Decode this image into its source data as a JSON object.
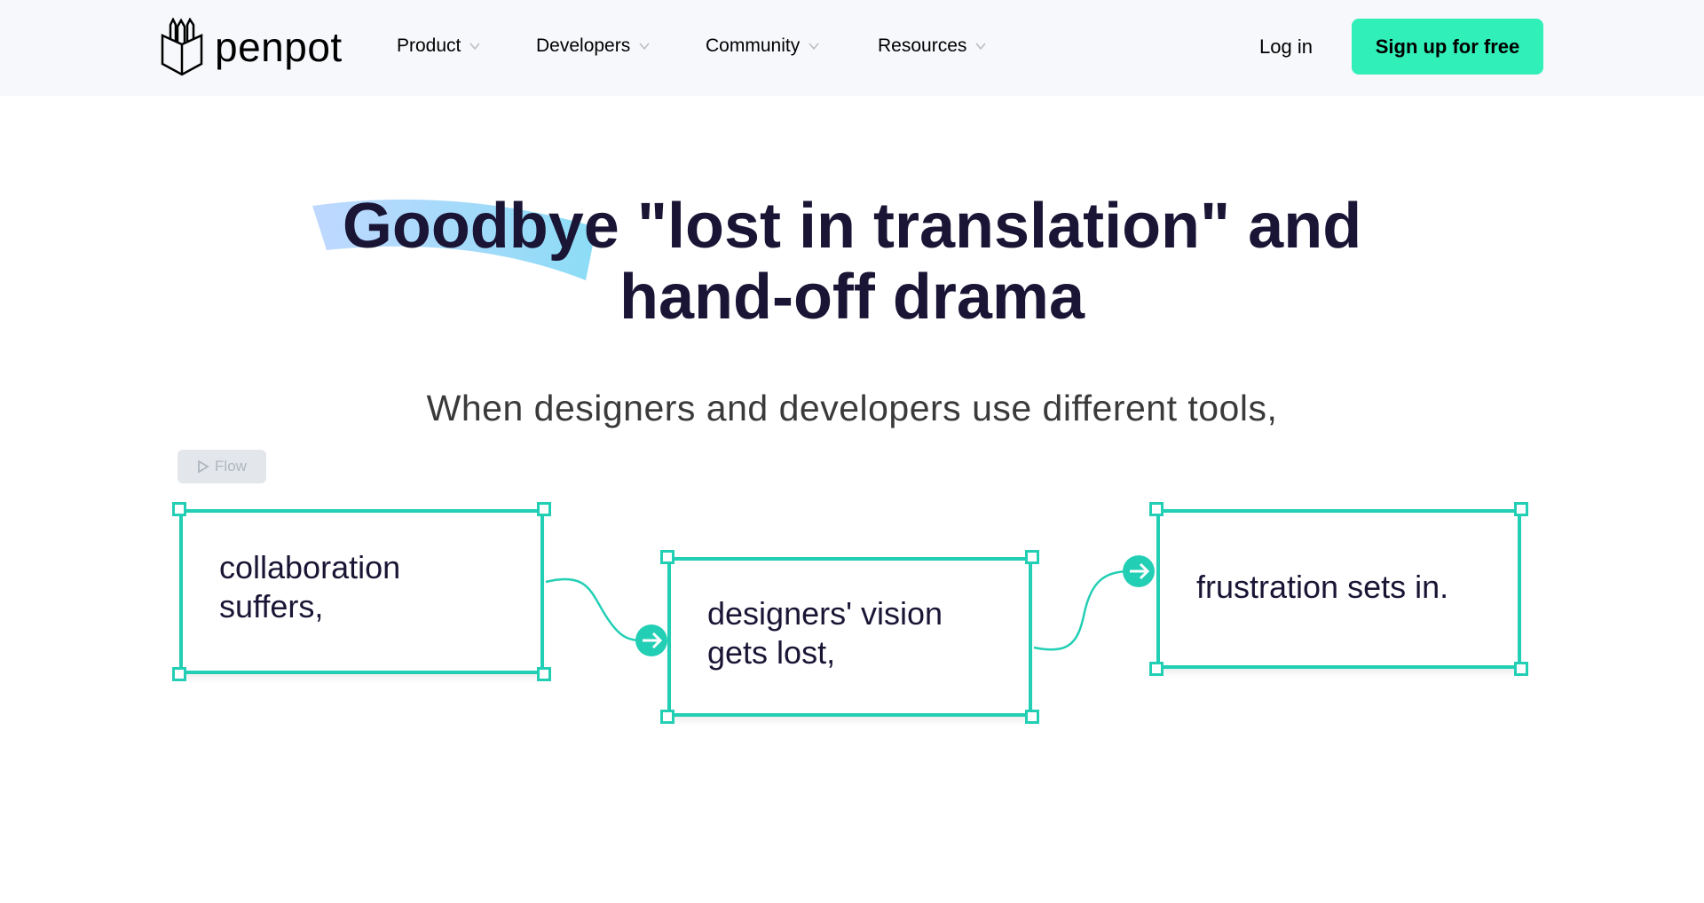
{
  "nav": {
    "logo_text": "penpot",
    "items": [
      {
        "label": "Product"
      },
      {
        "label": "Developers"
      },
      {
        "label": "Community"
      },
      {
        "label": "Resources"
      }
    ],
    "login": "Log in",
    "signup": "Sign up for free"
  },
  "hero": {
    "headline_line1": "Goodbye \"lost in translation\" and",
    "headline_line2": "hand-off drama",
    "subtitle": "When designers and developers use different tools,"
  },
  "flow": {
    "label": "Flow",
    "boxes": [
      {
        "line1": "collaboration",
        "line2": "suffers,"
      },
      {
        "line1": "designers' vision",
        "line2": "gets lost,"
      },
      {
        "line1": "frustration sets in.",
        "line2": ""
      }
    ]
  },
  "colors": {
    "accent": "#31efb8",
    "frame": "#22cfb4",
    "text": "#1a1535"
  }
}
